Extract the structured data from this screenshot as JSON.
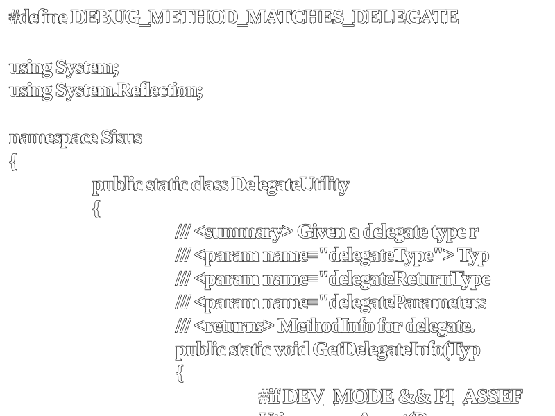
{
  "code": {
    "lines": [
      "#define DEBUG_METHOD_MATCHES_DELEGATE",
      "using System;",
      "using System.Reflection;",
      "namespace Sisus",
      "{",
      "public static class DelegateUtility",
      "{",
      "/// <summary> Given a delegate type r",
      "/// <param name=\"delegateType\"> Typ",
      "/// <param name=\"delegateReturnType",
      "/// <param name=\"delegateParameters",
      "/// <returns> MethodInfo for delegate.",
      "public static void GetDelegateInfo(Typ",
      "{",
      "#if DEV_MODE && PI_ASSEF",
      "Uti                  Assert(D"
    ]
  }
}
